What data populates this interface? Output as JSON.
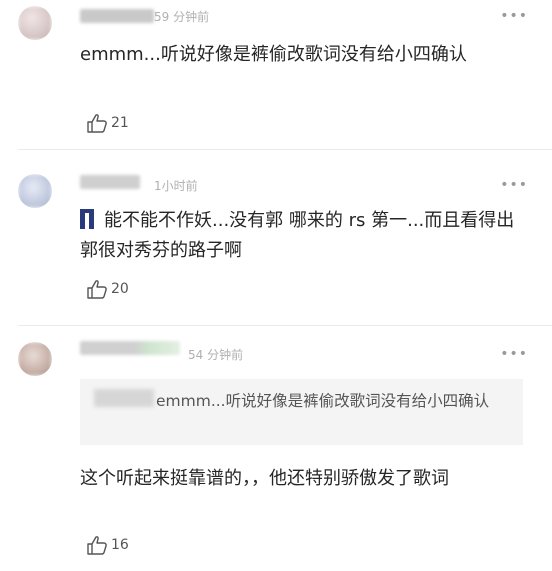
{
  "comments": [
    {
      "time": "59 分钟前",
      "more": "•••",
      "text": "emmm...听说好像是裤偷改歌词没有给小四确认",
      "likes": "21"
    },
    {
      "time": "1小时前",
      "more": "•••",
      "text": "能不能不作妖...没有郭 哪来的 rs 第一...而且看得出郭很对秀芬的路子啊",
      "likes": "20"
    },
    {
      "time": "54 分钟前",
      "more": "•••",
      "quote_text": "emmm...听说好像是裤偷改歌词没有给小四确认",
      "text": "这个听起来挺靠谱的，，他还特别骄傲发了歌词",
      "likes": "16"
    }
  ],
  "icons": {
    "like": "thumbs-up-icon",
    "more": "more-dots-icon",
    "pants": "jeans-emoji-icon"
  }
}
